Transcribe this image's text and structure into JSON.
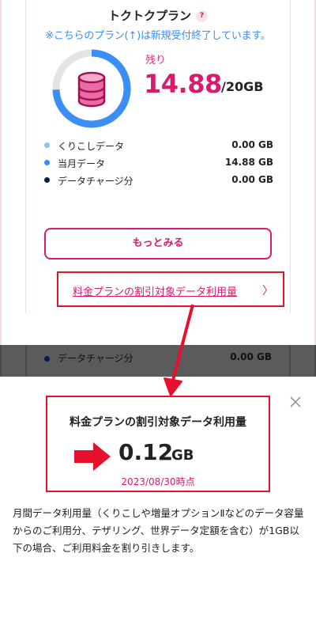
{
  "plan": {
    "title": "トクトクプラン",
    "help_badge": "?",
    "notice": "※こちらのプラン(↑)は新規受付終了しています。"
  },
  "remaining": {
    "label": "残り",
    "value": "14.88",
    "total": "/20GB",
    "fraction_remaining": 0.744
  },
  "breakdown": [
    {
      "name": "くりこしデータ",
      "value": "0.00 GB",
      "color": "#8ec3ee"
    },
    {
      "name": "当月データ",
      "value": "14.88 GB",
      "color": "#3a8ef6"
    },
    {
      "name": "データチャージ分",
      "value": "0.00 GB",
      "color": "#0d1a4a"
    }
  ],
  "buttons": {
    "more": "もっとみる"
  },
  "discount_link": {
    "label": "料金プランの割引対象データ利用量",
    "chevron": "〉"
  },
  "overlay_row": {
    "name": "データチャージ分",
    "value": "0.00 GB"
  },
  "sheet": {
    "title": "料金プランの割引対象データ利用量",
    "usage_value": "0.12",
    "usage_unit": "GB",
    "as_of": "2023/08/30時点",
    "description": "月間データ利用量（くりこしや増量オプションⅡなどのデータ容量からのご利用分、テザリング、世界データ定額を含む）が1GB以下の場合、ご利用料金を割り引きします。"
  },
  "colors": {
    "brand_pink": "#d81b6e",
    "accent_blue": "#3a8ef6",
    "annotation_red": "#e8112d"
  }
}
